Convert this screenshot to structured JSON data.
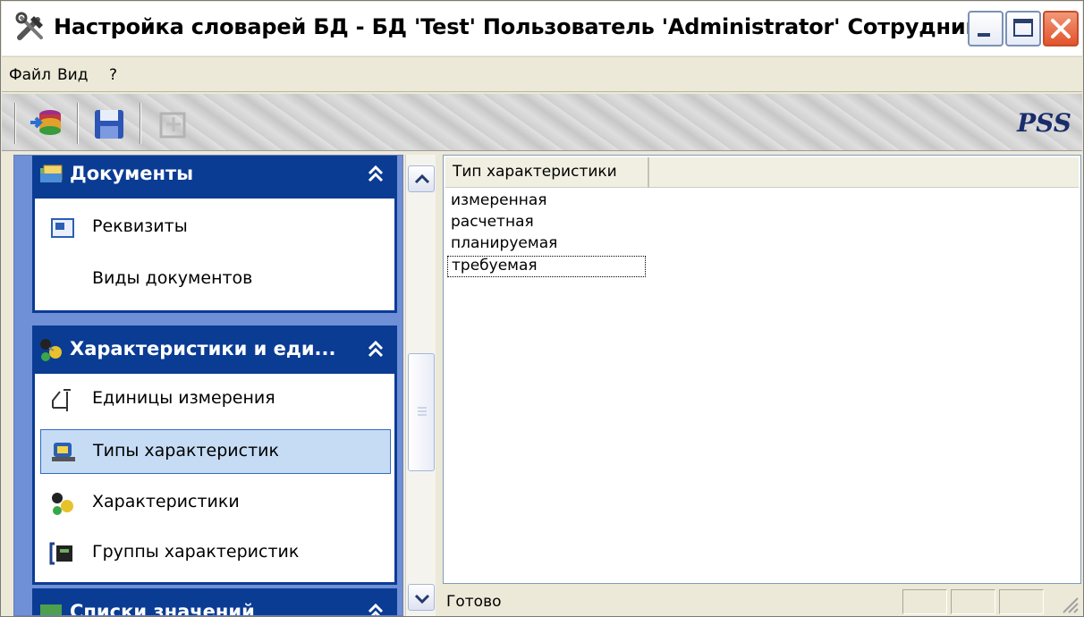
{
  "window": {
    "title": "Настройка словарей БД - БД 'Test' Пользователь 'Administrator' Сотрудник Не о...",
    "controls": [
      "minimize-icon",
      "maximize-icon",
      "close-icon"
    ]
  },
  "menu": {
    "items": [
      "Файл",
      "Вид",
      "?"
    ]
  },
  "toolbar": {
    "buttons": [
      "database-connect-icon",
      "save-icon",
      "filter-icon"
    ],
    "logo": "PSS"
  },
  "explorer": {
    "groups": [
      {
        "title": "Документы",
        "icon": "documents-icon",
        "items": [
          {
            "label": "Реквизиты",
            "icon": "requisites-icon"
          },
          {
            "label": "Виды документов",
            "icon": ""
          }
        ]
      },
      {
        "title": "Характеристики и еди...",
        "icon": "characteristics-group-icon",
        "items": [
          {
            "label": "Единицы измерения",
            "icon": "units-icon"
          },
          {
            "label": "Типы характеристик",
            "icon": "characteristic-types-icon",
            "selected": true
          },
          {
            "label": "Характеристики",
            "icon": "characteristics-icon"
          },
          {
            "label": "Группы характеристик",
            "icon": "characteristic-groups-icon"
          }
        ]
      },
      {
        "title": "Списки значений",
        "icon": "value-lists-icon",
        "items": []
      }
    ]
  },
  "list": {
    "column_header": "Тип характеристики",
    "rows": [
      "измеренная",
      "расчетная",
      "планируемая",
      "требуемая"
    ],
    "focused_row": "требуемая"
  },
  "status": {
    "text": "Готово"
  },
  "colors": {
    "explorer_background": "#6f8fd6",
    "group_header": "#0b3c94",
    "selection": "#c6dcf5",
    "window_face": "#ece9d8"
  }
}
